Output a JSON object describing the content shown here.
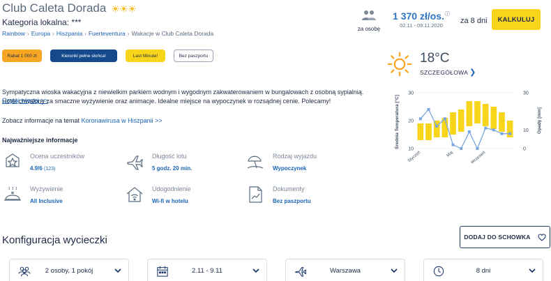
{
  "header": {
    "hotel_name": "Club Caleta Dorada",
    "category_label": "Kategoria lokalna: ***",
    "breadcrumb": [
      "Rainbow",
      "Europa",
      "Hiszpania",
      "Fuerteventura",
      "Wakacje w Club Caleta Dorada"
    ],
    "persons_label": "za osobę",
    "price": "1 370 zł/os.",
    "price_info": "ⓘ",
    "dates": "02.11 - 09.11.2020",
    "duration": "za 8 dni",
    "calc_button": "KALKULUJ"
  },
  "tags": [
    "Rabat 1 000 zł",
    "Kierunki pełne słońca!",
    "Last Minute!",
    "Bez paszportu"
  ],
  "weather": {
    "temperature": "18°C",
    "details_link": "SZCZEGÓŁOWA",
    "chevron": "❯"
  },
  "description": {
    "text": "Sympatyczna wioska wakacyjna z niewielkim parkiem wodnym i wygodnym zakwaterowaniem w bungalowach z osobną sypialnią. Hotel chwalony za smaczne wyżywienie oraz animacje. Idealne miejsce na wypoczynek w rozsądnej cenie. Polecamy!",
    "more_link": "Czytaj więcej >>",
    "covid_prefix": "Zobacz informacje na temat ",
    "covid_link": "Koronawirusa w Hiszpanii >>"
  },
  "info": {
    "section_title": "Najważniejsze informacje",
    "items": [
      {
        "title": "Ocena uczestników",
        "value": "4.9/6",
        "value_small": "(123)"
      },
      {
        "title": "Długość lotu",
        "value": "5 godz. 20 min.",
        "value_small": ""
      },
      {
        "title": "Rodzaj wyjazdu",
        "value": "Wypoczynek",
        "value_small": ""
      },
      {
        "title": "Wyżywienie",
        "value": "All Inclusive",
        "value_small": ""
      },
      {
        "title": "Udogodnienie",
        "value": "Wi-fi w hotelu",
        "value_small": ""
      },
      {
        "title": "Dokumenty",
        "value": "Bez paszportu",
        "value_small": ""
      }
    ]
  },
  "chart_data": {
    "type": "bar",
    "ylabel": "Średnia Temperatura [°C]",
    "y2label": "Opady [mm]",
    "ylim": [
      10,
      30
    ],
    "y2lim": [
      0,
      30
    ],
    "yticks": [
      "30",
      "20",
      "10"
    ],
    "y2ticks": [
      "30",
      "10",
      "0"
    ],
    "xticks": [
      "Styczeń",
      "Maj",
      "Wrzesień"
    ],
    "temp_range_series": [
      {
        "low": 13,
        "high": 19
      },
      {
        "low": 13,
        "high": 19
      },
      {
        "low": 14,
        "high": 20
      },
      {
        "low": 14,
        "high": 21
      },
      {
        "low": 15,
        "high": 23
      },
      {
        "low": 16,
        "high": 24
      },
      {
        "low": 18,
        "high": 27
      },
      {
        "low": 19,
        "high": 27
      },
      {
        "low": 18,
        "high": 26
      },
      {
        "low": 17,
        "high": 25
      },
      {
        "low": 16,
        "high": 23
      },
      {
        "low": 14,
        "high": 20
      }
    ],
    "precipitation": [
      16,
      21,
      12,
      16,
      2,
      0,
      9,
      0,
      11,
      10,
      8,
      8
    ],
    "bar_color": "#f7d51b",
    "line_color": "#7aa6e0"
  },
  "config": {
    "title": "Konfiguracja wycieczki",
    "save_button": "DODAJ DO SCHOWKA",
    "selects": [
      "2 osoby, 1 pokój",
      "2.11 - 9.11",
      "Warszawa",
      "8 dni"
    ]
  },
  "colors": {
    "accent_blue": "#1a64b5",
    "yellow": "#f7d51b",
    "orange": "#f6a623",
    "navy": "#144a8c"
  }
}
